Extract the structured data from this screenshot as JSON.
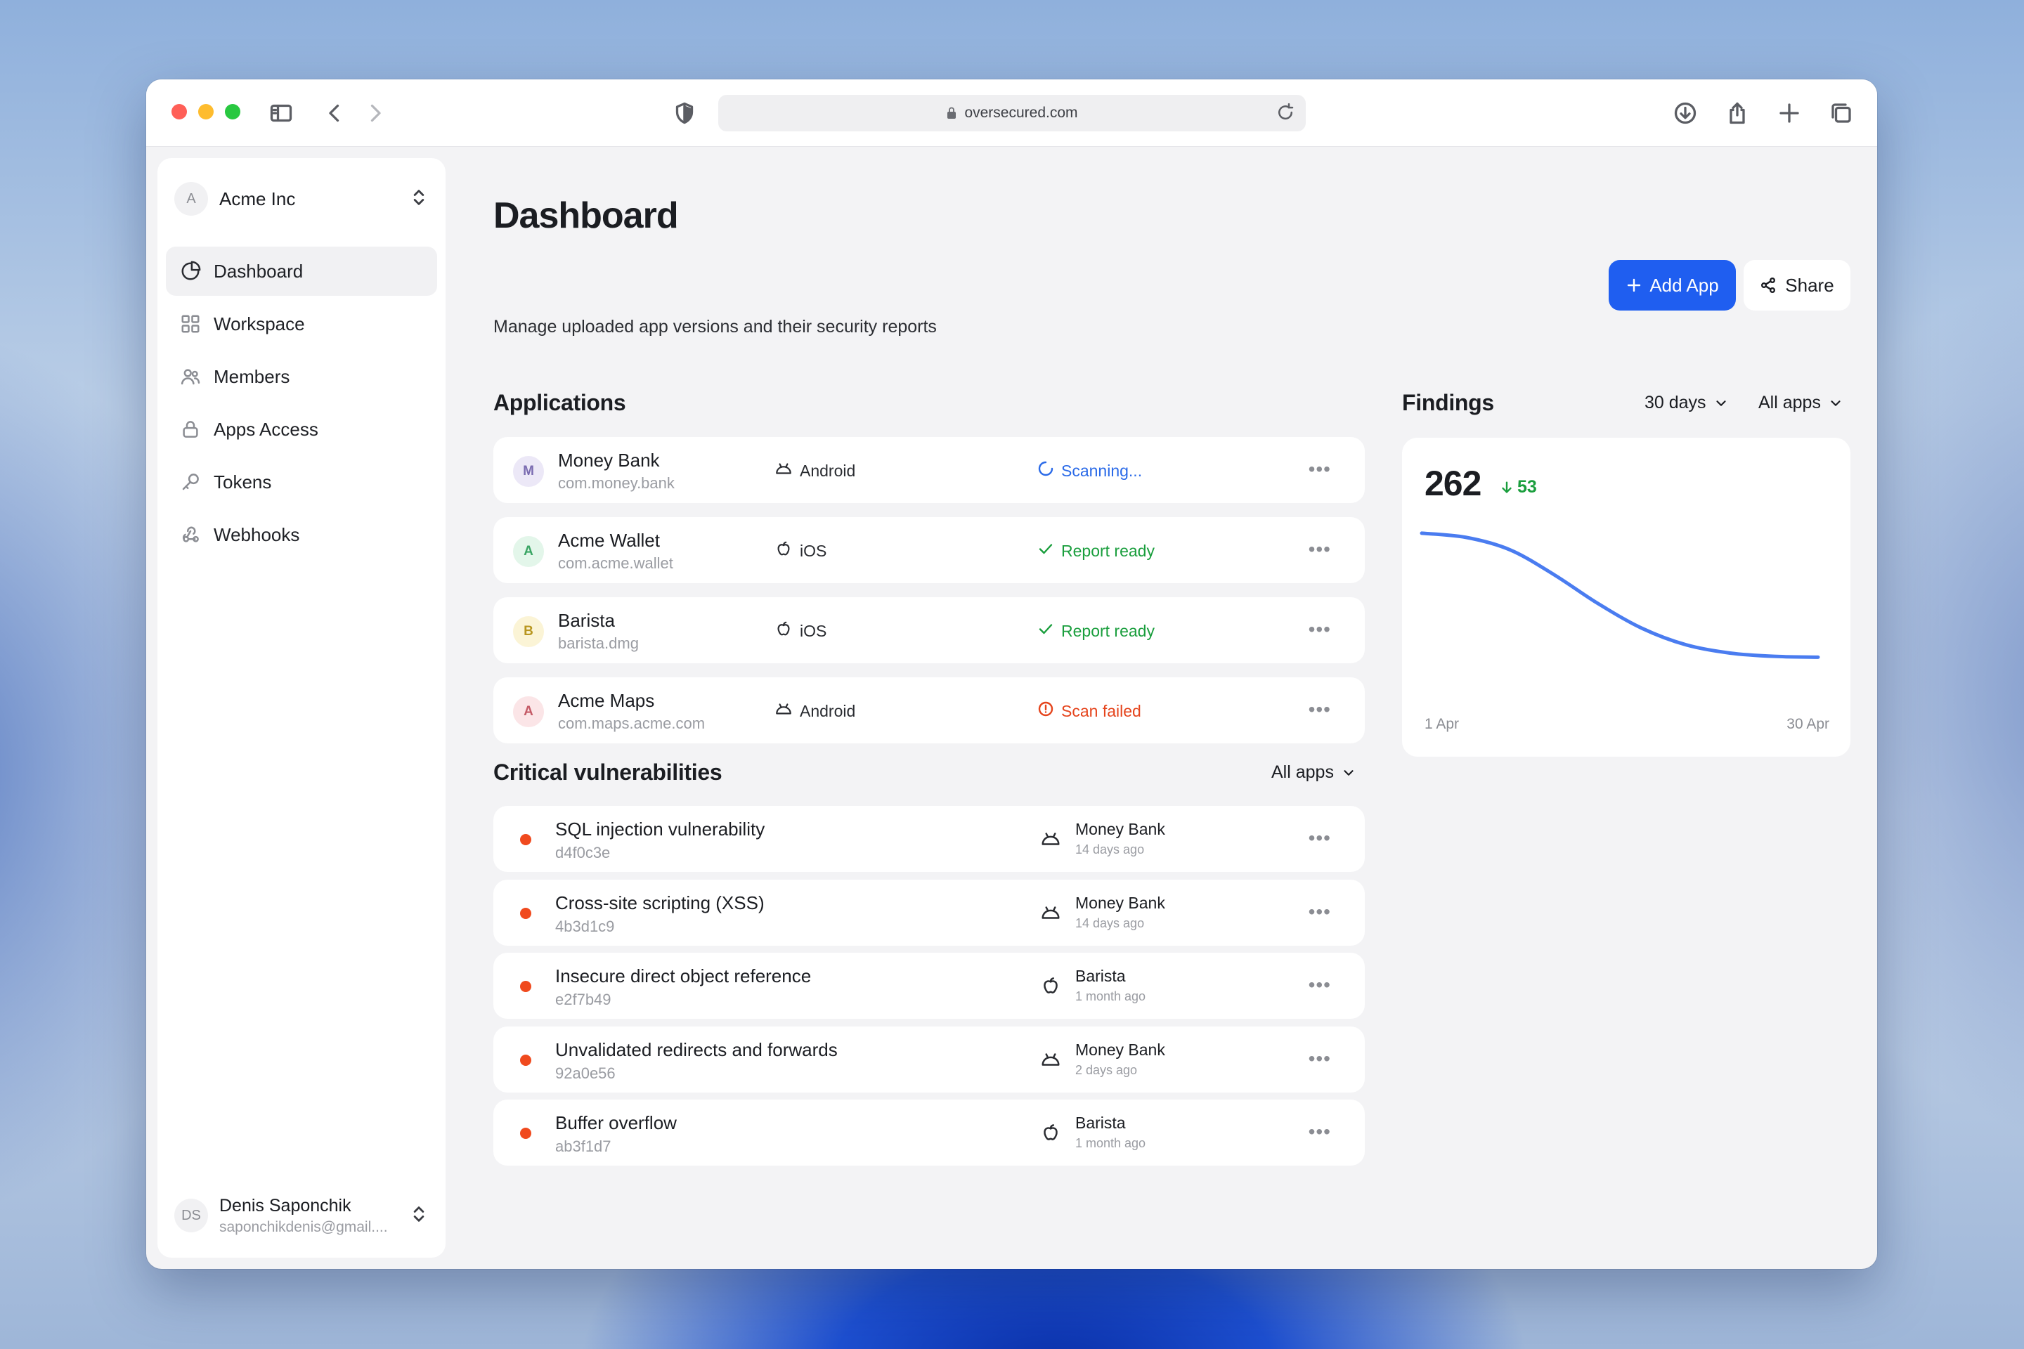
{
  "browser": {
    "url": "oversecured.com"
  },
  "sidebar": {
    "org": {
      "initial": "A",
      "name": "Acme Inc"
    },
    "items": [
      {
        "label": "Dashboard",
        "icon": "dashboard-icon",
        "active": true
      },
      {
        "label": "Workspace",
        "icon": "grid-icon",
        "active": false
      },
      {
        "label": "Members",
        "icon": "users-icon",
        "active": false
      },
      {
        "label": "Apps Access",
        "icon": "lock-icon",
        "active": false
      },
      {
        "label": "Tokens",
        "icon": "key-icon",
        "active": false
      },
      {
        "label": "Webhooks",
        "icon": "webhook-icon",
        "active": false
      }
    ],
    "user": {
      "initials": "DS",
      "name": "Denis Saponchik",
      "email": "saponchikdenis@gmail...."
    }
  },
  "header": {
    "title": "Dashboard",
    "subtitle": "Manage uploaded app versions and their security reports",
    "add_label": "Add App",
    "share_label": "Share"
  },
  "applications": {
    "title": "Applications",
    "rows": [
      {
        "initial": "M",
        "name": "Money Bank",
        "package": "com.money.bank",
        "platform": "Android",
        "status": "Scanning...",
        "status_kind": "scanning",
        "avatar_bg": "#ece8f7",
        "avatar_fg": "#7a6bb0"
      },
      {
        "initial": "A",
        "name": "Acme Wallet",
        "package": "com.acme.wallet",
        "platform": "iOS",
        "status": "Report ready",
        "status_kind": "ready",
        "avatar_bg": "#e3f6ea",
        "avatar_fg": "#3aa564"
      },
      {
        "initial": "B",
        "name": "Barista",
        "package": "barista.dmg",
        "platform": "iOS",
        "status": "Report ready",
        "status_kind": "ready",
        "avatar_bg": "#fbf4d6",
        "avatar_fg": "#b8961f"
      },
      {
        "initial": "A",
        "name": "Acme Maps",
        "package": "com.maps.acme.com",
        "platform": "Android",
        "status": "Scan failed",
        "status_kind": "failed",
        "avatar_bg": "#fbe5e7",
        "avatar_fg": "#c45a66"
      }
    ]
  },
  "vulnerabilities": {
    "title": "Critical vulnerabilities",
    "filter": "All apps",
    "rows": [
      {
        "title": "SQL injection vulnerability",
        "hash": "d4f0c3e",
        "platform": "Android",
        "app": "Money Bank",
        "time": "14 days ago"
      },
      {
        "title": "Cross-site scripting (XSS)",
        "hash": "4b3d1c9",
        "platform": "Android",
        "app": "Money Bank",
        "time": "14 days ago"
      },
      {
        "title": "Insecure direct object reference",
        "hash": "e2f7b49",
        "platform": "iOS",
        "app": "Barista",
        "time": "1 month ago"
      },
      {
        "title": "Unvalidated redirects and forwards",
        "hash": "92a0e56",
        "platform": "Android",
        "app": "Money Bank",
        "time": "2 days ago"
      },
      {
        "title": "Buffer overflow",
        "hash": "ab3f1d7",
        "platform": "iOS",
        "app": "Barista",
        "time": "1 month ago"
      }
    ]
  },
  "findings": {
    "title": "Findings",
    "period_filter": "30 days",
    "app_filter": "All apps",
    "total": "262",
    "delta": "53"
  },
  "chart_data": {
    "type": "line",
    "x": [
      "1 Apr",
      "30 Apr"
    ],
    "series": [
      {
        "values": [
          315,
          310,
          295,
          265,
          230,
          200,
          180,
          170,
          166,
          165
        ]
      }
    ],
    "x_tick_labels": [
      "1 Apr",
      "30 Apr"
    ],
    "grid": false,
    "color": "#4a7cf0"
  },
  "colors": {
    "accent": "#1f5ef0",
    "scanning": "#2a6ae8",
    "ready": "#1a9e3d",
    "failed": "#e5441c",
    "critical": "#f04a1e"
  }
}
